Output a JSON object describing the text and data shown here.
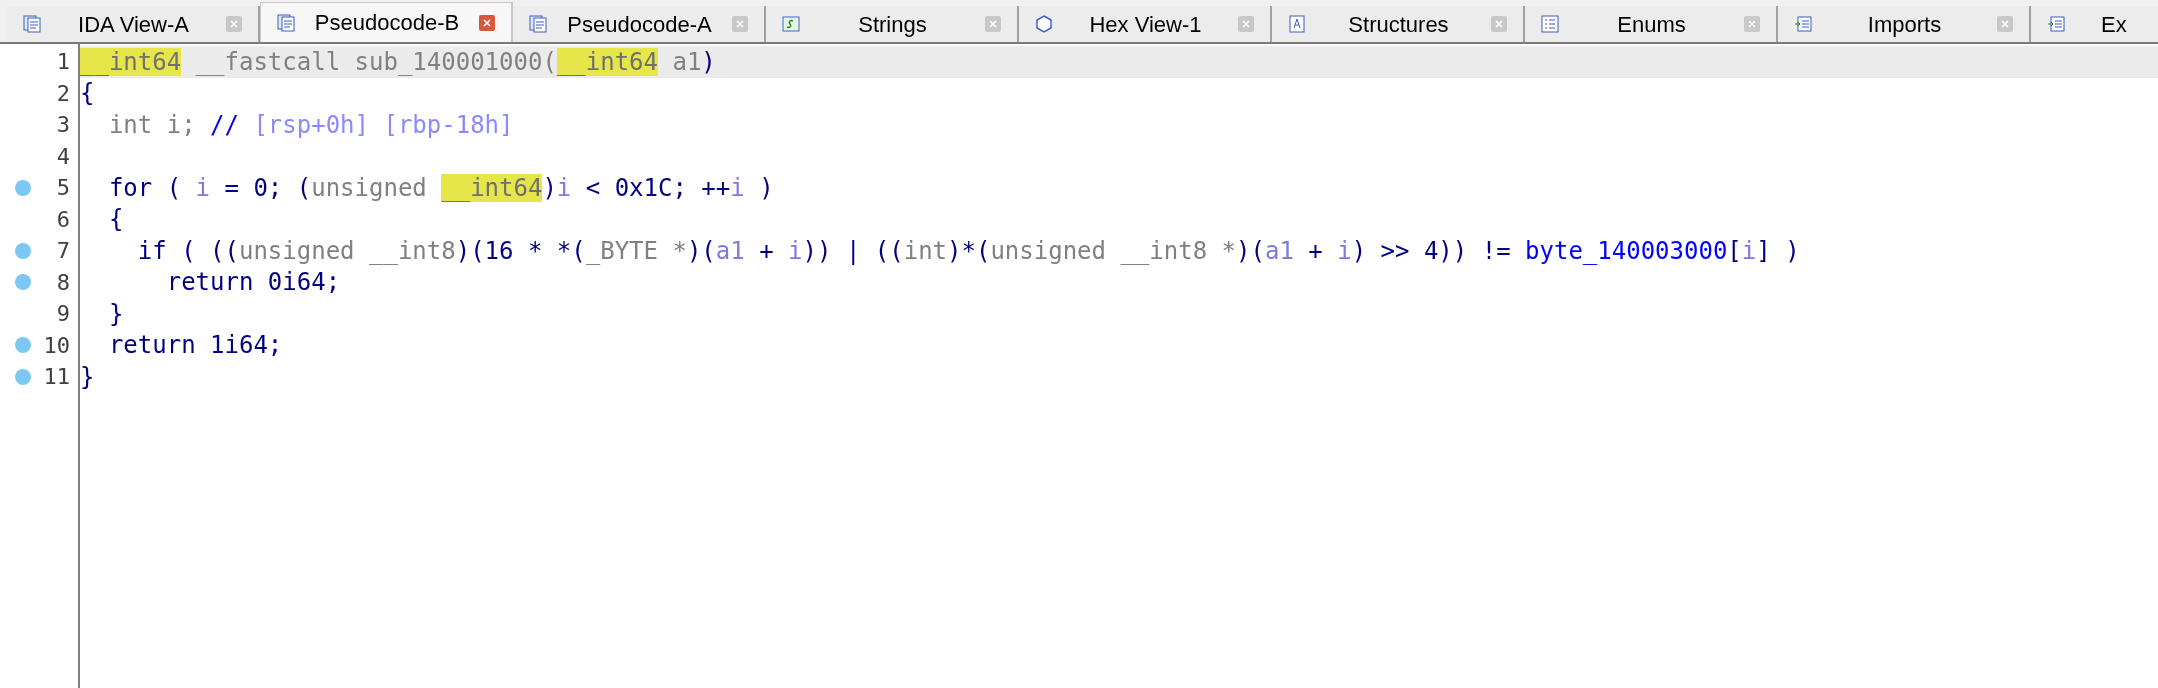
{
  "tabs": [
    {
      "label": "IDA View-A",
      "kind": "listing",
      "selected": false,
      "closable": true
    },
    {
      "label": "Pseudocode-B",
      "kind": "pseudocode",
      "selected": true,
      "closable": true
    },
    {
      "label": "Pseudocode-A",
      "kind": "pseudocode",
      "selected": false,
      "closable": true
    },
    {
      "label": "Strings",
      "kind": "strings",
      "selected": false,
      "closable": true
    },
    {
      "label": "Hex View-1",
      "kind": "hex",
      "selected": false,
      "closable": true
    },
    {
      "label": "Structures",
      "kind": "structures",
      "selected": false,
      "closable": true
    },
    {
      "label": "Enums",
      "kind": "enums",
      "selected": false,
      "closable": true
    },
    {
      "label": "Imports",
      "kind": "imports",
      "selected": false,
      "closable": true
    },
    {
      "label": "Ex",
      "kind": "exports",
      "selected": false,
      "closable": false
    }
  ],
  "lines": [
    {
      "number": "1",
      "breakpoint": false,
      "current": true,
      "tokens": [
        {
          "text": "__int64",
          "kind": "hl"
        },
        {
          "text": " __fastcall sub_140001000(",
          "kind": "type"
        },
        {
          "text": "__int64",
          "kind": "hl"
        },
        {
          "text": " a1",
          "kind": "type"
        },
        {
          "text": ")",
          "kind": "plain"
        }
      ]
    },
    {
      "number": "2",
      "breakpoint": false,
      "current": false,
      "tokens": [
        {
          "text": "{",
          "kind": "plain"
        }
      ]
    },
    {
      "number": "3",
      "breakpoint": false,
      "current": false,
      "tokens": [
        {
          "text": "  int i; ",
          "kind": "type"
        },
        {
          "text": "// ",
          "kind": "global"
        },
        {
          "text": "[rsp+0h] [rbp-18h]",
          "kind": "comment"
        }
      ]
    },
    {
      "number": "4",
      "breakpoint": false,
      "current": false
    },
    {
      "number": "5",
      "breakpoint": true,
      "current": false,
      "tokens": [
        {
          "text": "  for ( ",
          "kind": "plain"
        },
        {
          "text": "i",
          "kind": "var"
        },
        {
          "text": " = 0; (",
          "kind": "plain"
        },
        {
          "text": "unsigned ",
          "kind": "type"
        },
        {
          "text": "__int64",
          "kind": "hl"
        },
        {
          "text": ")",
          "kind": "plain"
        },
        {
          "text": "i",
          "kind": "var"
        },
        {
          "text": " < 0x1C; ++",
          "kind": "plain"
        },
        {
          "text": "i",
          "kind": "var"
        },
        {
          "text": " )",
          "kind": "plain"
        }
      ]
    },
    {
      "number": "6",
      "breakpoint": false,
      "current": false,
      "tokens": [
        {
          "text": "  {",
          "kind": "plain"
        }
      ]
    },
    {
      "number": "7",
      "breakpoint": true,
      "current": false,
      "tokens": [
        {
          "text": "    if ( ((",
          "kind": "plain"
        },
        {
          "text": "unsigned __int8",
          "kind": "type"
        },
        {
          "text": ")(16 * *(",
          "kind": "plain"
        },
        {
          "text": "_BYTE *",
          "kind": "type"
        },
        {
          "text": ")(",
          "kind": "plain"
        },
        {
          "text": "a1",
          "kind": "var"
        },
        {
          "text": " + ",
          "kind": "plain"
        },
        {
          "text": "i",
          "kind": "var"
        },
        {
          "text": ")) | ((",
          "kind": "plain"
        },
        {
          "text": "int",
          "kind": "type"
        },
        {
          "text": ")*(",
          "kind": "plain"
        },
        {
          "text": "unsigned __int8 *",
          "kind": "type"
        },
        {
          "text": ")(",
          "kind": "plain"
        },
        {
          "text": "a1",
          "kind": "var"
        },
        {
          "text": " + ",
          "kind": "plain"
        },
        {
          "text": "i",
          "kind": "var"
        },
        {
          "text": ") >> 4)) != ",
          "kind": "plain"
        },
        {
          "text": "byte_140003000",
          "kind": "global"
        },
        {
          "text": "[",
          "kind": "plain"
        },
        {
          "text": "i",
          "kind": "var"
        },
        {
          "text": "] )",
          "kind": "plain"
        }
      ]
    },
    {
      "number": "8",
      "breakpoint": true,
      "current": false,
      "tokens": [
        {
          "text": "      return 0i64;",
          "kind": "plain"
        }
      ]
    },
    {
      "number": "9",
      "breakpoint": false,
      "current": false,
      "tokens": [
        {
          "text": "  }",
          "kind": "plain"
        }
      ]
    },
    {
      "number": "10",
      "breakpoint": true,
      "current": false,
      "tokens": [
        {
          "text": "  return 1i64;",
          "kind": "plain"
        }
      ]
    },
    {
      "number": "11",
      "breakpoint": true,
      "current": false,
      "tokens": [
        {
          "text": "}",
          "kind": "plain"
        }
      ]
    }
  ]
}
